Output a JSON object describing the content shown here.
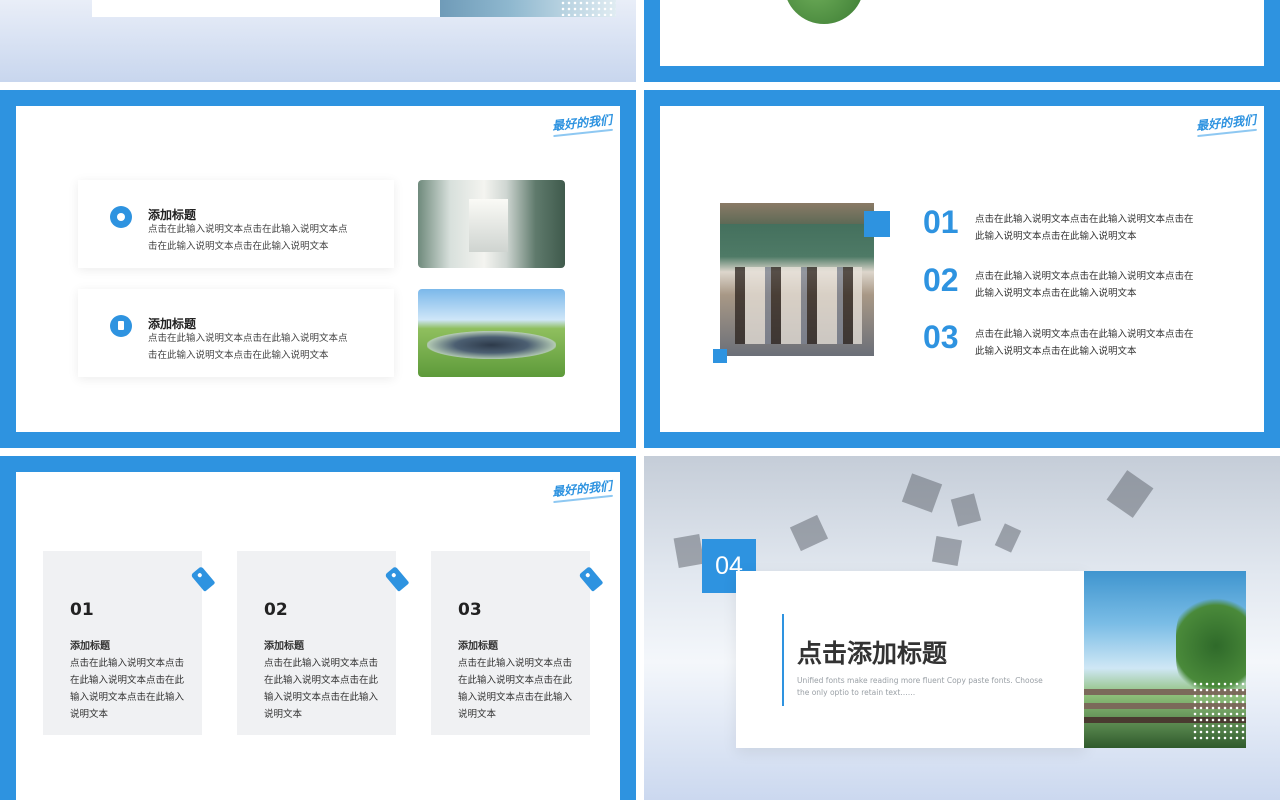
{
  "colors": {
    "accent": "#2e93e0",
    "text_dark": "#333333",
    "card_gray": "#f0f1f3"
  },
  "slide3": {
    "logo": "最好的我们",
    "items": [
      {
        "icon": "target-icon",
        "title": "添加标题",
        "text": "点击在此输入说明文本点击在此输入说明文本点击在此输入说明文本点击在此输入说明文本"
      },
      {
        "icon": "document-icon",
        "title": "添加标题",
        "text": "点击在此输入说明文本点击在此输入说明文本点击在此输入说明文本点击在此输入说明文本"
      }
    ]
  },
  "slide4": {
    "logo": "最好的我们",
    "items": [
      {
        "num": "01",
        "text": "点击在此输入说明文本点击在此输入说明文本点击在此输入说明文本点击在此输入说明文本"
      },
      {
        "num": "02",
        "text": "点击在此输入说明文本点击在此输入说明文本点击在此输入说明文本点击在此输入说明文本"
      },
      {
        "num": "03",
        "text": "点击在此输入说明文本点击在此输入说明文本点击在此输入说明文本点击在此输入说明文本"
      }
    ]
  },
  "slide5": {
    "logo": "最好的我们",
    "cards": [
      {
        "num": "01",
        "title": "添加标题",
        "text": "点击在此输入说明文本点击在此输入说明文本点击在此输入说明文本点击在此输入说明文本"
      },
      {
        "num": "02",
        "title": "添加标题",
        "text": "点击在此输入说明文本点击在此输入说明文本点击在此输入说明文本点击在此输入说明文本"
      },
      {
        "num": "03",
        "title": "添加标题",
        "text": "点击在此输入说明文本点击在此输入说明文本点击在此输入说明文本点击在此输入说明文本"
      }
    ]
  },
  "slide6": {
    "badge": "04",
    "title": "点击添加标题",
    "subtitle": "Unified fonts make reading more fluent Copy paste fonts. Choose the only optio to retain text……"
  }
}
